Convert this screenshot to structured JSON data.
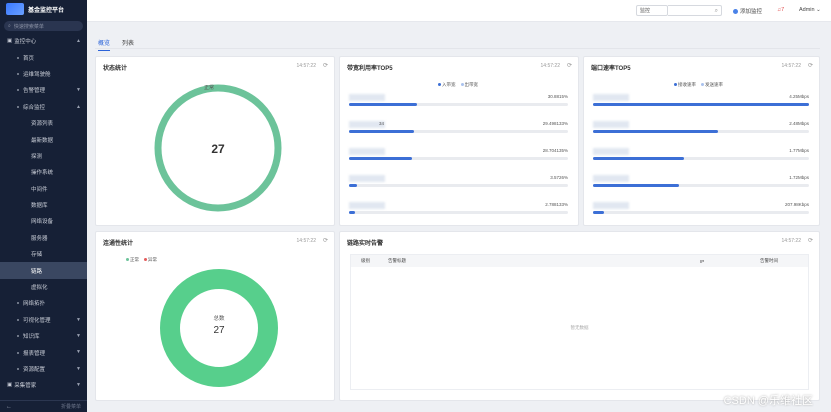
{
  "app": {
    "title": "基金监控平台"
  },
  "sidebar": {
    "search_placeholder": "快速搜索菜单",
    "items": [
      {
        "label": "监控中心",
        "level": 0,
        "chev": "▲"
      },
      {
        "label": "首页",
        "level": 1
      },
      {
        "label": "运维驾驶舱",
        "level": 1
      },
      {
        "label": "告警管理",
        "level": 1,
        "chev": "▼"
      },
      {
        "label": "综合监控",
        "level": 1,
        "chev": "▲"
      },
      {
        "label": "资源列表",
        "level": 2
      },
      {
        "label": "最新数据",
        "level": 2
      },
      {
        "label": "探测",
        "level": 2
      },
      {
        "label": "操作系统",
        "level": 2
      },
      {
        "label": "中间件",
        "level": 2
      },
      {
        "label": "数据库",
        "level": 2
      },
      {
        "label": "网络设备",
        "level": 2
      },
      {
        "label": "服务器",
        "level": 2
      },
      {
        "label": "存储",
        "level": 2
      },
      {
        "label": "链路",
        "level": 2,
        "active": true
      },
      {
        "label": "虚拟化",
        "level": 2
      },
      {
        "label": "网络拓扑",
        "level": 1
      },
      {
        "label": "可视化管理",
        "level": 1,
        "chev": "▼"
      },
      {
        "label": "知识库",
        "level": 1,
        "chev": "▼"
      },
      {
        "label": "报表管理",
        "level": 1,
        "chev": "▼"
      },
      {
        "label": "资源配置",
        "level": 1,
        "chev": "▼"
      },
      {
        "label": "采集管家",
        "level": 0,
        "chev": "▼"
      }
    ],
    "bottom_icon": "←",
    "bottom_text": "折叠菜单"
  },
  "header": {
    "select_value": "监控",
    "add_label": "添加监控",
    "alarm_count": "7",
    "user": "Admin"
  },
  "tabs": [
    {
      "label": "概览",
      "active": true
    },
    {
      "label": "列表",
      "active": false
    }
  ],
  "panels": {
    "status": {
      "title": "状态统计",
      "time": "14:57:22",
      "normal_label": "正常",
      "total": "27",
      "chart_data": {
        "type": "pie",
        "labels": [
          "正常"
        ],
        "values": [
          27
        ],
        "colors": [
          "#6cc39a"
        ]
      }
    },
    "bandwidth": {
      "title": "带宽利用率TOP5",
      "time": "14:57:22",
      "legend": [
        "入带宽",
        "出带宽"
      ],
      "legend_colors": [
        "#3c6fd6",
        "#a9c2ee"
      ],
      "rows": [
        {
          "label": "",
          "value": "30.8815%",
          "pct": 30.88
        },
        {
          "label": "34",
          "value": "29.498133%",
          "pct": 29.5
        },
        {
          "label": "",
          "value": "28.704135%",
          "pct": 28.7
        },
        {
          "label": "",
          "value": "3.5726%",
          "pct": 3.57
        },
        {
          "label": "",
          "value": "2.788133%",
          "pct": 2.79
        }
      ]
    },
    "port": {
      "title": "端口速率TOP5",
      "time": "14:57:22",
      "legend": [
        "接收速率",
        "发送速率"
      ],
      "legend_colors": [
        "#3c6fd6",
        "#a9c2ee"
      ],
      "rows": [
        {
          "value": "4.25Mbps",
          "pct": 100
        },
        {
          "value": "2.48Mbps",
          "pct": 58
        },
        {
          "value": "1.77Mbps",
          "pct": 42
        },
        {
          "value": "1.72Mbps",
          "pct": 40
        },
        {
          "value": "207.98Kbps",
          "pct": 5
        }
      ]
    },
    "connectivity": {
      "title": "连通性统计",
      "time": "14:57:22",
      "legend": [
        "正常",
        "异常"
      ],
      "legend_colors": [
        "#6cc39a",
        "#e45b5b"
      ],
      "center_label": "总数",
      "total": "27",
      "chart_data": {
        "type": "pie",
        "labels": [
          "正常",
          "异常"
        ],
        "values": [
          27,
          0
        ],
        "colors": [
          "#57cf8c",
          "#e45b5b"
        ]
      }
    },
    "alarms": {
      "title": "链路实时告警",
      "time": "14:57:22",
      "columns": [
        "级别",
        "告警标题",
        "IP",
        "告警时间"
      ],
      "empty_text": "暂无数据"
    }
  },
  "watermark": "CSDN @乐维社区"
}
